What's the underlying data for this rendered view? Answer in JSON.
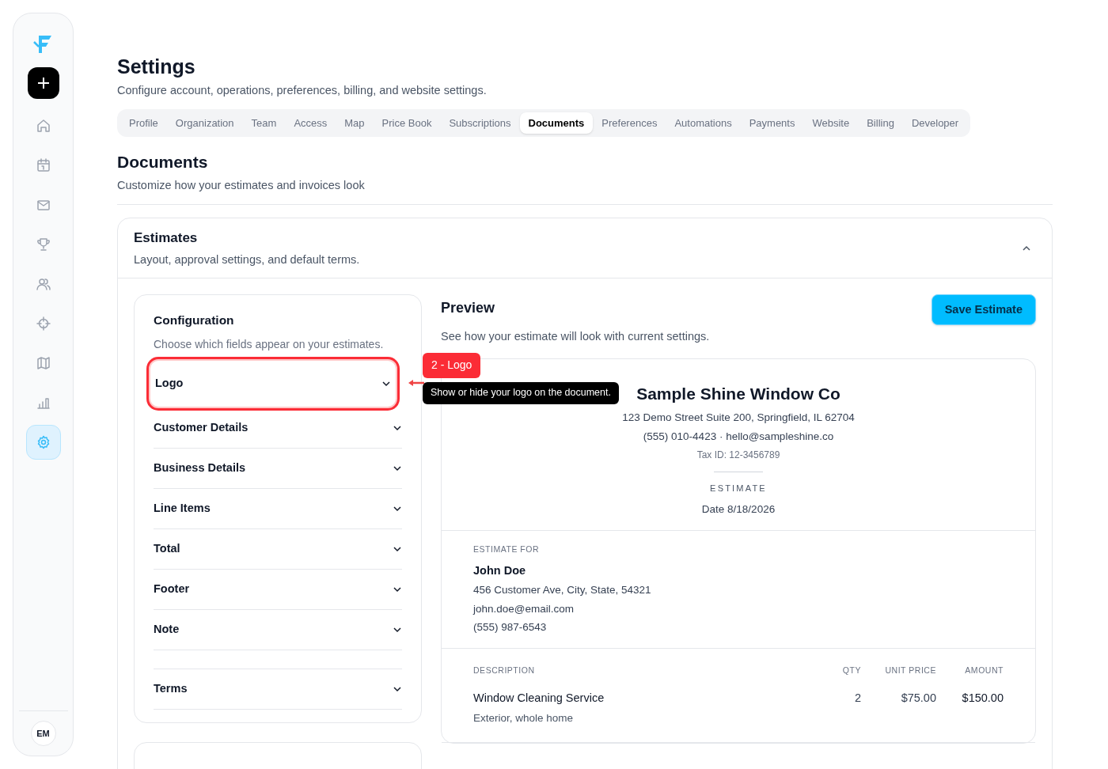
{
  "sidebar": {
    "avatar": "EM",
    "nav": [
      {
        "selected": false
      },
      {
        "selected": false
      },
      {
        "selected": false
      },
      {
        "selected": false
      },
      {
        "selected": false
      },
      {
        "selected": false
      },
      {
        "selected": false
      },
      {
        "selected": false
      },
      {
        "selected": true
      }
    ]
  },
  "page": {
    "title": "Settings",
    "subtitle": "Configure account, operations, preferences, billing, and website settings."
  },
  "tabs": [
    {
      "label": "Profile",
      "selected": false
    },
    {
      "label": "Organization",
      "selected": false
    },
    {
      "label": "Team",
      "selected": false
    },
    {
      "label": "Access",
      "selected": false
    },
    {
      "label": "Map",
      "selected": false
    },
    {
      "label": "Price Book",
      "selected": false
    },
    {
      "label": "Subscriptions",
      "selected": false
    },
    {
      "label": "Documents",
      "selected": true
    },
    {
      "label": "Preferences",
      "selected": false
    },
    {
      "label": "Automations",
      "selected": false
    },
    {
      "label": "Payments",
      "selected": false
    },
    {
      "label": "Website",
      "selected": false
    },
    {
      "label": "Billing",
      "selected": false
    },
    {
      "label": "Developer",
      "selected": false
    }
  ],
  "section": {
    "title": "Documents",
    "subtitle": "Customize how your estimates and invoices look"
  },
  "estimates": {
    "title": "Estimates",
    "subtitle": "Layout, approval settings, and default terms.",
    "expanded": true,
    "configuration": {
      "title": "Configuration",
      "subtitle": "Choose which fields appear on your estimates.",
      "items": [
        {
          "label": "Logo",
          "highlighted": true,
          "annotation": "2 - Logo",
          "tooltip": "Show or hide your logo on the document."
        },
        {
          "label": "Customer Details",
          "highlighted": false
        },
        {
          "label": "Business Details",
          "highlighted": false
        },
        {
          "label": "Line Items",
          "highlighted": false
        },
        {
          "label": "Total",
          "highlighted": false
        },
        {
          "label": "Footer",
          "highlighted": false
        },
        {
          "label": "Note",
          "highlighted": false
        },
        {
          "kind": "spacer"
        },
        {
          "label": "Terms",
          "highlighted": false
        }
      ]
    },
    "preview": {
      "title": "Preview",
      "subtitle": "See how your estimate will look with current settings.",
      "save_button": "Save Estimate",
      "document": {
        "company": "Sample Shine Window Co",
        "address": "123 Demo Street Suite 200, Springfield, IL 62704",
        "contact": "(555) 010-4423 · hello@sampleshine.co",
        "tax_id": "Tax ID: 12-3456789",
        "doc_type": "ESTIMATE",
        "date": "Date 8/18/2026",
        "estimate_for": {
          "label": "ESTIMATE FOR",
          "name": "John Doe",
          "lines": [
            "456 Customer Ave, City, State, 54321",
            "john.doe@email.com",
            "(555) 987-6543"
          ]
        },
        "table": {
          "columns": [
            "DESCRIPTION",
            "QTY",
            "UNIT PRICE",
            "AMOUNT"
          ],
          "rows": [
            {
              "description": "Window Cleaning Service",
              "detail": "Exterior, whole home",
              "qty": "2",
              "unit_price": "$75.00",
              "amount": "$150.00"
            }
          ]
        }
      }
    }
  }
}
